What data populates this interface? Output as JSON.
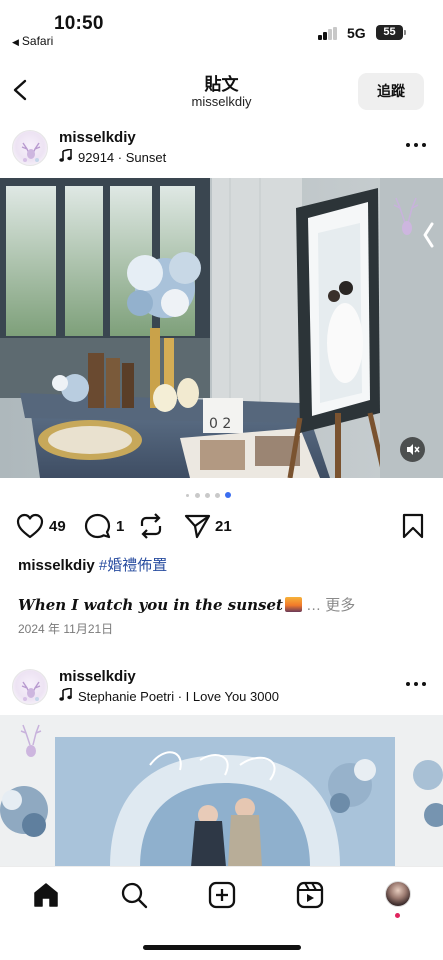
{
  "status_bar": {
    "time": "10:50",
    "back_app": "Safari",
    "network": "5G",
    "battery": "55"
  },
  "header": {
    "title": "貼文",
    "subtitle": "misselkdiy",
    "follow_label": "追蹤"
  },
  "posts": [
    {
      "username": "misselkdiy",
      "music": "92914 · Sunset",
      "likes": "49",
      "comments": "1",
      "shares": "21",
      "caption_user": "misselkdiy",
      "caption_tag": "#婚禮佈置",
      "caption_text": "When I watch you in the sunset",
      "more_label": "… 更多",
      "date": "2024 年 11月21日",
      "carousel_index": 5,
      "carousel_total": 5
    },
    {
      "username": "misselkdiy",
      "music": "Stephanie Poetri · I Love You 3000"
    }
  ],
  "bottom_nav": [
    "home-icon",
    "search-icon",
    "create-icon",
    "reels-icon",
    "profile-avatar"
  ],
  "colors": {
    "hashtag": "#2a4ea0",
    "carousel_active": "#3a6df0",
    "notification": "#e0245e"
  }
}
